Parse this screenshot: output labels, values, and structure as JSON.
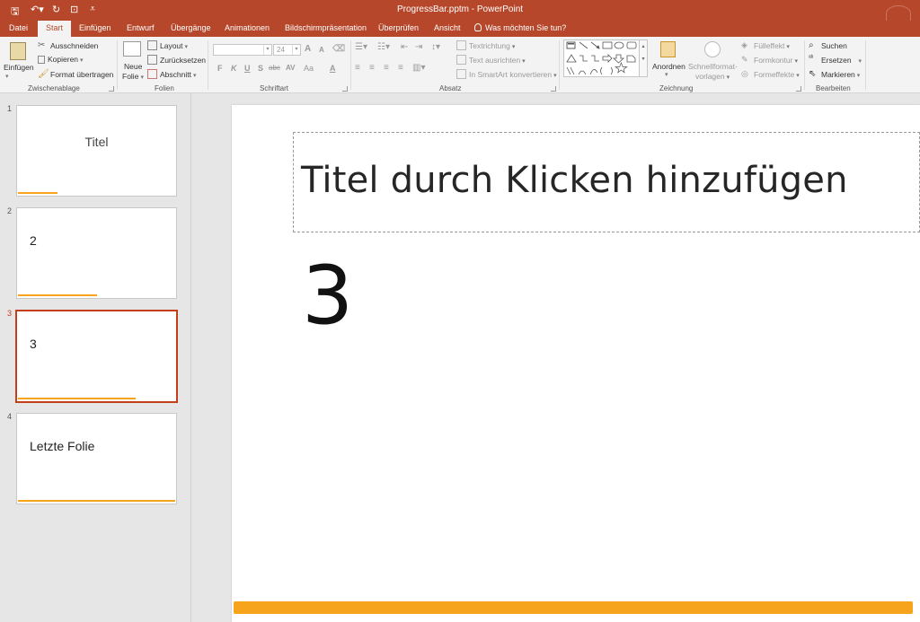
{
  "window": {
    "title": "ProgressBar.pptm - PowerPoint"
  },
  "colors": {
    "accent": "#b7472a",
    "selection": "#c43e1c",
    "progress": "#f6a41c"
  },
  "tabs": {
    "file": "Datei",
    "home": "Start",
    "insert": "Einfügen",
    "design": "Entwurf",
    "transitions": "Übergänge",
    "animations": "Animationen",
    "slideshow": "Bildschirmpräsentation",
    "review": "Überprüfen",
    "view": "Ansicht",
    "tell_me": "Was möchten Sie tun?"
  },
  "ribbon": {
    "clipboard": {
      "label": "Zwischenablage",
      "paste": "Einfügen",
      "cut": "Ausschneiden",
      "copy": "Kopieren",
      "format_painter": "Format übertragen"
    },
    "slides": {
      "label": "Folien",
      "new_slide_line1": "Neue",
      "new_slide_line2": "Folie",
      "layout": "Layout",
      "reset": "Zurücksetzen",
      "section": "Abschnitt"
    },
    "font": {
      "label": "Schriftart",
      "font_name": "",
      "font_size": "24",
      "bold": "F",
      "italic": "K",
      "underline": "U",
      "strike": "S",
      "shadow": "abc",
      "spacing": "AV",
      "case": "Aa",
      "grow": "A",
      "shrink": "A",
      "color": "A"
    },
    "paragraph": {
      "label": "Absatz",
      "text_direction": "Textrichtung",
      "align_text": "Text ausrichten",
      "smartart": "In SmartArt konvertieren"
    },
    "drawing": {
      "label": "Zeichnung",
      "arrange": "Anordnen",
      "quick_styles_line1": "Schnellformat-",
      "quick_styles_line2": "vorlagen",
      "shape_fill": "Fülleffekt",
      "shape_outline": "Formkontur",
      "shape_effects": "Formeffekte"
    },
    "editing": {
      "label": "Bearbeiten",
      "find": "Suchen",
      "replace": "Ersetzen",
      "select": "Markieren"
    }
  },
  "thumbnails": [
    {
      "number": "1",
      "text": "Titel",
      "progress": 0.25
    },
    {
      "number": "2",
      "text": "2",
      "progress": 0.5
    },
    {
      "number": "3",
      "text": "3",
      "progress": 0.75
    },
    {
      "number": "4",
      "text": "Letzte Folie",
      "progress": 1.0
    }
  ],
  "slide": {
    "title_placeholder": "Titel durch Klicken hinzufügen",
    "content": "3",
    "progress": 1.0
  }
}
